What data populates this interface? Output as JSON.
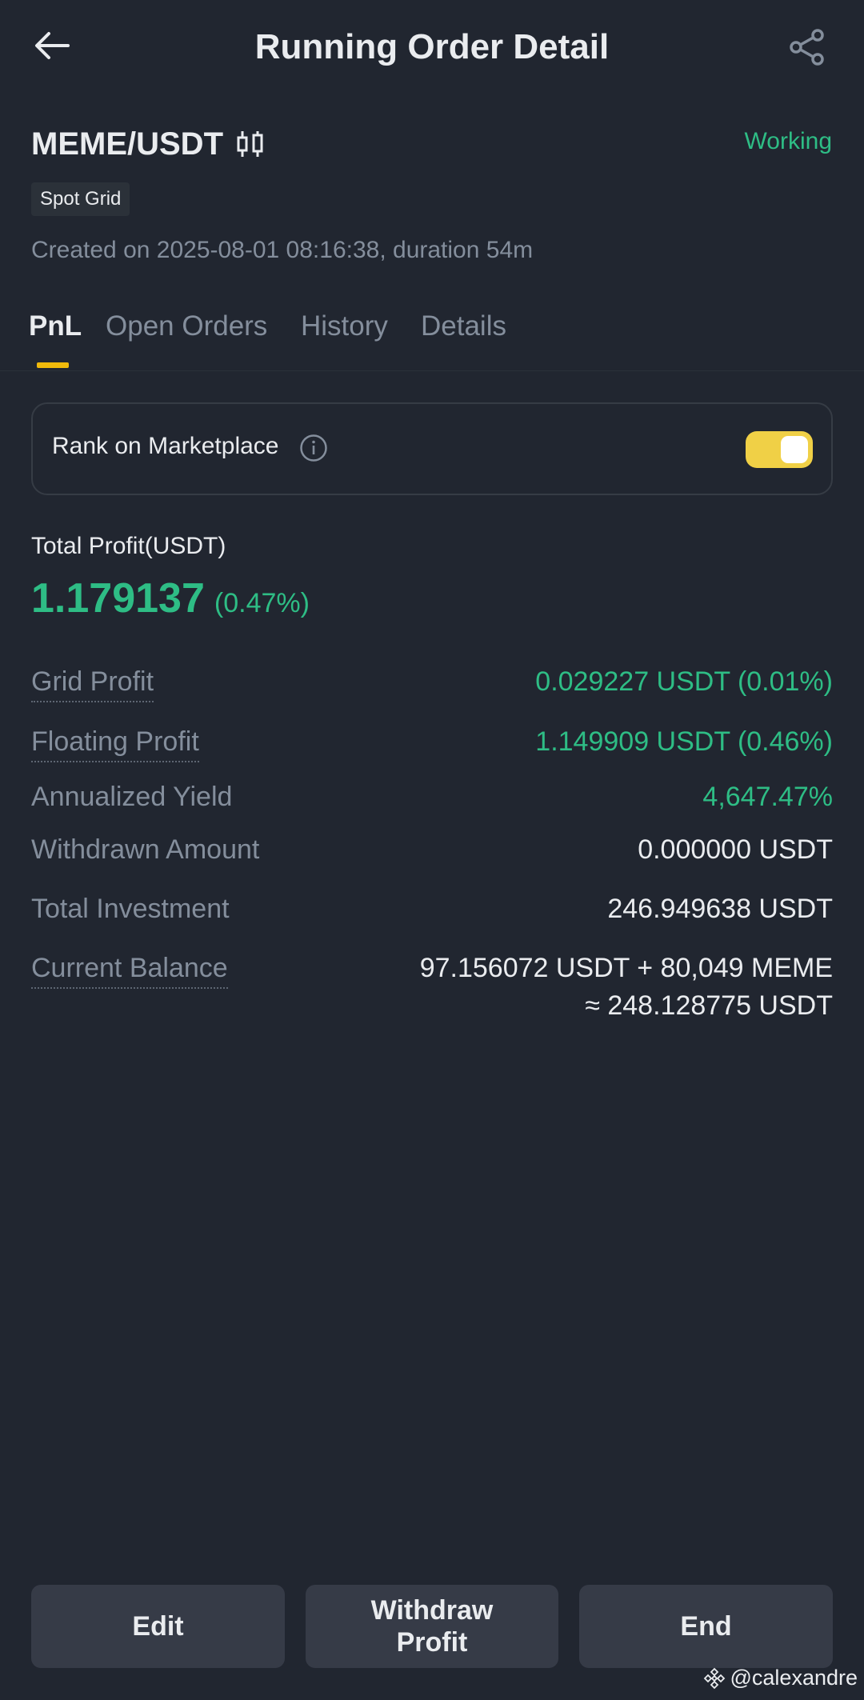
{
  "header": {
    "title": "Running Order Detail",
    "back_icon": "arrow-left-icon",
    "share_icon": "share-icon"
  },
  "order": {
    "pair": "MEME/USDT",
    "status": "Working",
    "strategy_badge": "Spot Grid",
    "created": "Created on 2025-08-01 08:16:38, duration 54m"
  },
  "tabs": [
    {
      "label": "PnL",
      "active": true
    },
    {
      "label": "Open Orders",
      "active": false
    },
    {
      "label": "History",
      "active": false
    },
    {
      "label": "Details",
      "active": false
    }
  ],
  "rank": {
    "label": "Rank on Marketplace",
    "enabled": true
  },
  "profit": {
    "label": "Total Profit(USDT)",
    "amount": "1.179137",
    "pct": "(0.47%)"
  },
  "stats": [
    {
      "label": "Grid Profit",
      "value": "0.029227 USDT (0.01%)"
    },
    {
      "label": "Floating Profit",
      "value": "1.149909 USDT (0.46%)"
    },
    {
      "label": "Annualized Yield",
      "value": "4,647.47%"
    },
    {
      "label": "Withdrawn Amount",
      "value": "0.000000 USDT"
    },
    {
      "label": "Total Investment",
      "value": "246.949638 USDT"
    },
    {
      "label": "Current Balance",
      "value": "97.156072 USDT + 80,049 MEME",
      "value_line2": "≈ 248.128775 USDT"
    }
  ],
  "actions": {
    "edit": "Edit",
    "withdraw_line1": "Withdraw",
    "withdraw_line2": "Profit",
    "end": "End"
  },
  "watermark": "@calexandre",
  "colors": {
    "background": "#212630",
    "positive": "#2ebd85",
    "accent": "#f0b90b",
    "muted": "#848e9c"
  }
}
